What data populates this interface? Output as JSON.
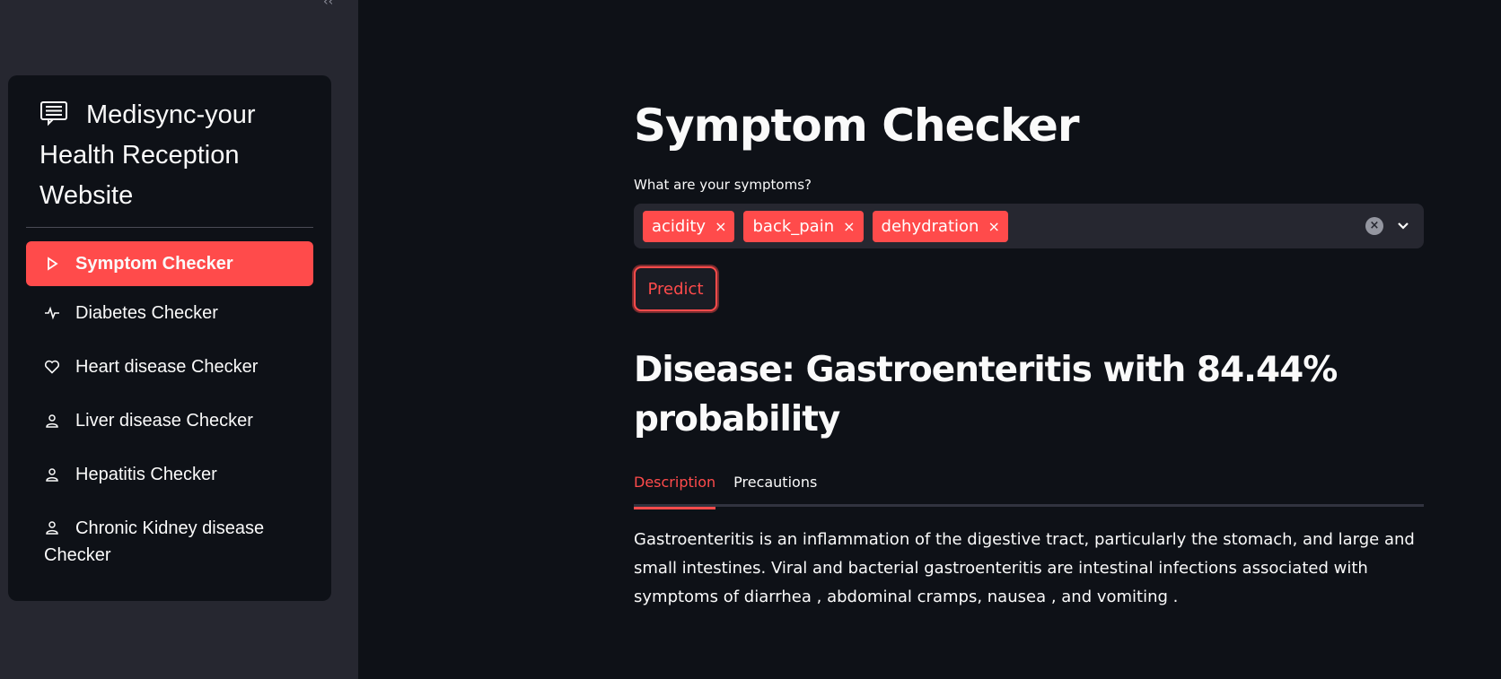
{
  "sidebar": {
    "collapse_glyph": "‹‹",
    "title": "Medisync-your Health Reception Website",
    "title_icon": "list-document-icon",
    "items": [
      {
        "label": "Symptom Checker",
        "icon": "play-icon",
        "active": true
      },
      {
        "label": "Diabetes Checker",
        "icon": "activity-icon",
        "active": false
      },
      {
        "label": "Heart disease Checker",
        "icon": "heart-icon",
        "active": false
      },
      {
        "label": "Liver disease Checker",
        "icon": "person-icon",
        "active": false
      },
      {
        "label": "Hepatitis Checker",
        "icon": "person-icon",
        "active": false
      },
      {
        "label": "Chronic Kidney disease Checker",
        "icon": "person-icon",
        "active": false
      }
    ]
  },
  "main": {
    "title": "Symptom Checker",
    "symptoms_label": "What are your symptoms?",
    "selected_symptoms": [
      "acidity",
      "back_pain",
      "dehydration"
    ],
    "tag_remove_glyph": "×",
    "clear_glyph": "×",
    "predict_label": "Predict",
    "result": "Disease: Gastroenteritis with 84.44% probability",
    "tabs": [
      {
        "label": "Description",
        "active": true
      },
      {
        "label": "Precautions",
        "active": false
      }
    ],
    "description": "Gastroenteritis is an inflammation of the digestive tract, particularly the stomach, and large and small intestines. Viral and bacterial gastroenteritis are intestinal infections associated with symptoms of diarrhea , abdominal cramps, nausea , and vomiting ."
  },
  "colors": {
    "accent": "#ff4b4b",
    "background": "#0e1117",
    "sidebar": "#262730",
    "input": "#262730"
  }
}
